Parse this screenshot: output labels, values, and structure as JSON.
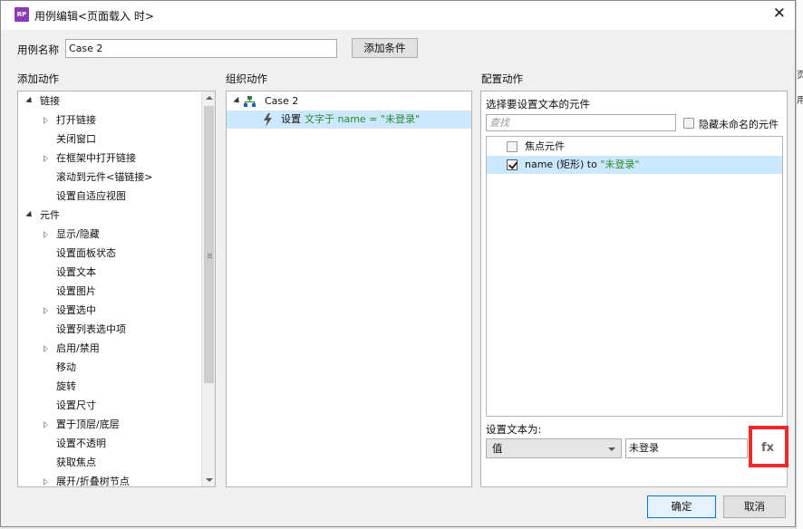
{
  "window": {
    "title": "用例编辑<页面载入 时>",
    "app_icon": "RP"
  },
  "case_name": {
    "label": "用例名称",
    "value": "Case 2",
    "add_condition_label": "添加条件"
  },
  "add_actions": {
    "heading": "添加动作",
    "items": [
      {
        "label": "链接",
        "level": 0,
        "expander": "expanded"
      },
      {
        "label": "打开链接",
        "level": 1,
        "expander": "collapsed"
      },
      {
        "label": "关闭窗口",
        "level": 1,
        "expander": "none"
      },
      {
        "label": "在框架中打开链接",
        "level": 1,
        "expander": "collapsed"
      },
      {
        "label": "滚动到元件<锚链接>",
        "level": 1,
        "expander": "none"
      },
      {
        "label": "设置自适应视图",
        "level": 1,
        "expander": "none"
      },
      {
        "label": "元件",
        "level": 0,
        "expander": "expanded"
      },
      {
        "label": "显示/隐藏",
        "level": 1,
        "expander": "collapsed"
      },
      {
        "label": "设置面板状态",
        "level": 1,
        "expander": "none"
      },
      {
        "label": "设置文本",
        "level": 1,
        "expander": "none"
      },
      {
        "label": "设置图片",
        "level": 1,
        "expander": "none"
      },
      {
        "label": "设置选中",
        "level": 1,
        "expander": "collapsed"
      },
      {
        "label": "设置列表选中项",
        "level": 1,
        "expander": "none"
      },
      {
        "label": "启用/禁用",
        "level": 1,
        "expander": "collapsed"
      },
      {
        "label": "移动",
        "level": 1,
        "expander": "none"
      },
      {
        "label": "旋转",
        "level": 1,
        "expander": "none"
      },
      {
        "label": "设置尺寸",
        "level": 1,
        "expander": "none"
      },
      {
        "label": "置于顶层/底层",
        "level": 1,
        "expander": "collapsed"
      },
      {
        "label": "设置不透明",
        "level": 1,
        "expander": "none"
      },
      {
        "label": "获取焦点",
        "level": 1,
        "expander": "none"
      },
      {
        "label": "展开/折叠树节点",
        "level": 1,
        "expander": "collapsed"
      }
    ]
  },
  "organize_actions": {
    "heading": "组织动作",
    "case_label": "Case 2",
    "action_prefix": "设置",
    "action_detail": "文字于 name = \"未登录\""
  },
  "configure_actions": {
    "heading": "配置动作",
    "select_widget_label": "选择要设置文本的元件",
    "search_placeholder": "查找",
    "hide_unnamed_label": "隐藏未命名的元件",
    "widgets": [
      {
        "label_plain": "焦点元件",
        "label_green": "",
        "checked": false
      },
      {
        "label_plain": "name (矩形) to ",
        "label_green": "\"未登录\"",
        "checked": true
      }
    ],
    "set_text_label": "设置文本为:",
    "value_type": "值",
    "value_text": "未登录",
    "fx_label": "fx"
  },
  "footer": {
    "ok_label": "确定",
    "cancel_label": "取消"
  },
  "right_peek": [
    "页",
    "用"
  ],
  "colors": {
    "selection": "#cce8ff",
    "highlight": "#ee2a2a",
    "green_text": "#2a8a2a"
  }
}
